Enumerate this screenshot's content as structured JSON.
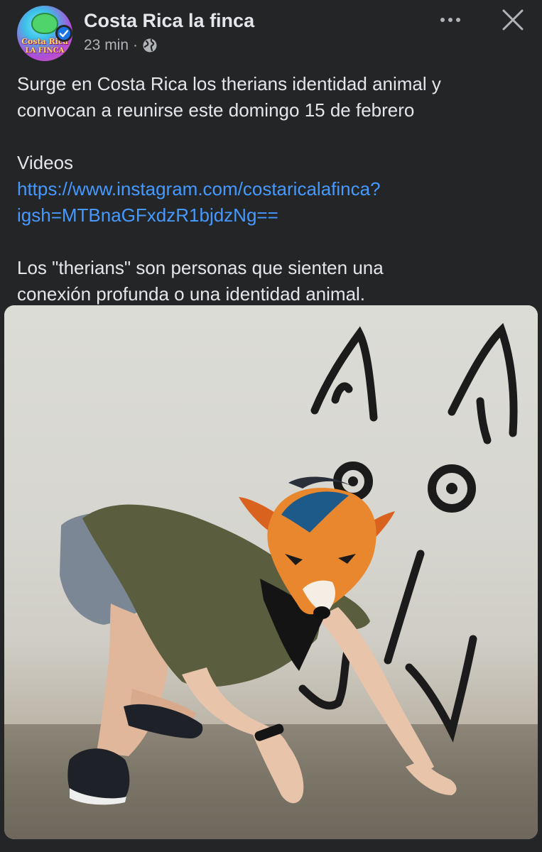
{
  "post": {
    "page_name": "Costa Rica la finca",
    "avatar_logo_line1": "Costa Rica",
    "avatar_logo_line2": "LA FINCA",
    "time_ago": "23 min",
    "separator": "·",
    "audience_icon": "globe-icon",
    "verified_icon": "verified-badge-icon",
    "more_icon": "more-options-icon",
    "close_icon": "close-icon",
    "text_line1": "Surge en Costa Rica los therians identidad animal y",
    "text_line2": "convocan a reunirse este domingo 15 de febrero",
    "videos_label": "Videos",
    "link_line1": "https://www.instagram.com/costaricalafinca?",
    "link_line2": "igsh=MTBnaGFxdzR1bjdzNg==",
    "text_line3": "Los \"therians\" son personas que sienten una",
    "text_line4": "conexión profunda o una identidad animal."
  },
  "colors": {
    "background": "#242526",
    "text": "#e4e6eb",
    "secondary_text": "#b0b3b8",
    "link": "#4599ff",
    "verified": "#1b74e4"
  }
}
